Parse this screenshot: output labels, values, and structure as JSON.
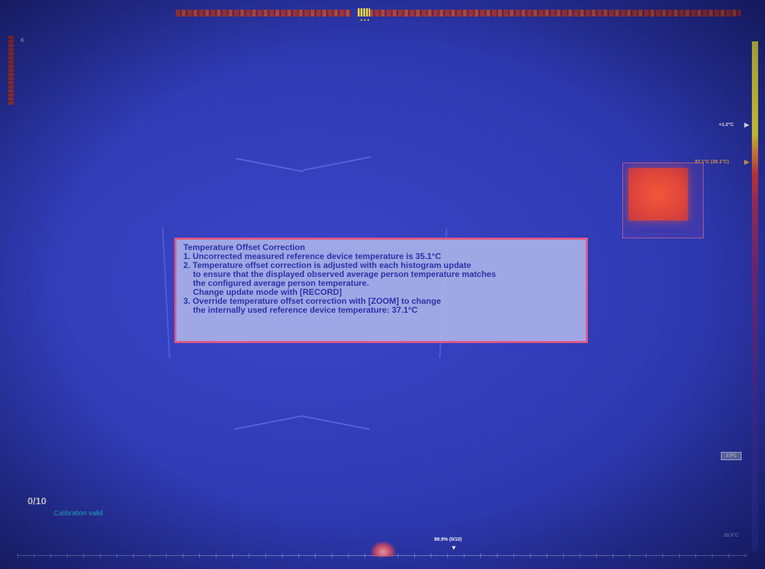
{
  "info_panel": {
    "title": "Temperature Offset Correction",
    "lines": [
      "1. Uncorrected measured reference device temperature is 35.1°C",
      "2. Temperature offset correction is adjusted with each histogram update",
      "to ensure that the displayed observed average person temperature matches",
      "the configured average person temperature.",
      "Change update mode with [RECORD]",
      "3. Override temperature offset correction with [ZOOM] to change",
      "the internally used reference device temperature: 37.1°C"
    ]
  },
  "status": {
    "counter": "0/10",
    "calibration": "Calibration valid"
  },
  "scale": {
    "high_label": "+1.0°C",
    "reference_label": "37.1°C (35.1°C)",
    "low_label": "2.0°C",
    "bottom_label": "33.5°C",
    "marker_arrow": "▶"
  },
  "histogram": {
    "percent_label": "99.9% (0/10)",
    "marker": "▼"
  },
  "top_marker_label": "▲▲▲",
  "corner_label": "K",
  "colors": {
    "background": "#2f3ab3",
    "panel_border": "#e05a86",
    "panel_text": "#2a33a6",
    "calibration_text": "#2ec9e0",
    "hot_spot": "#e1473a"
  }
}
